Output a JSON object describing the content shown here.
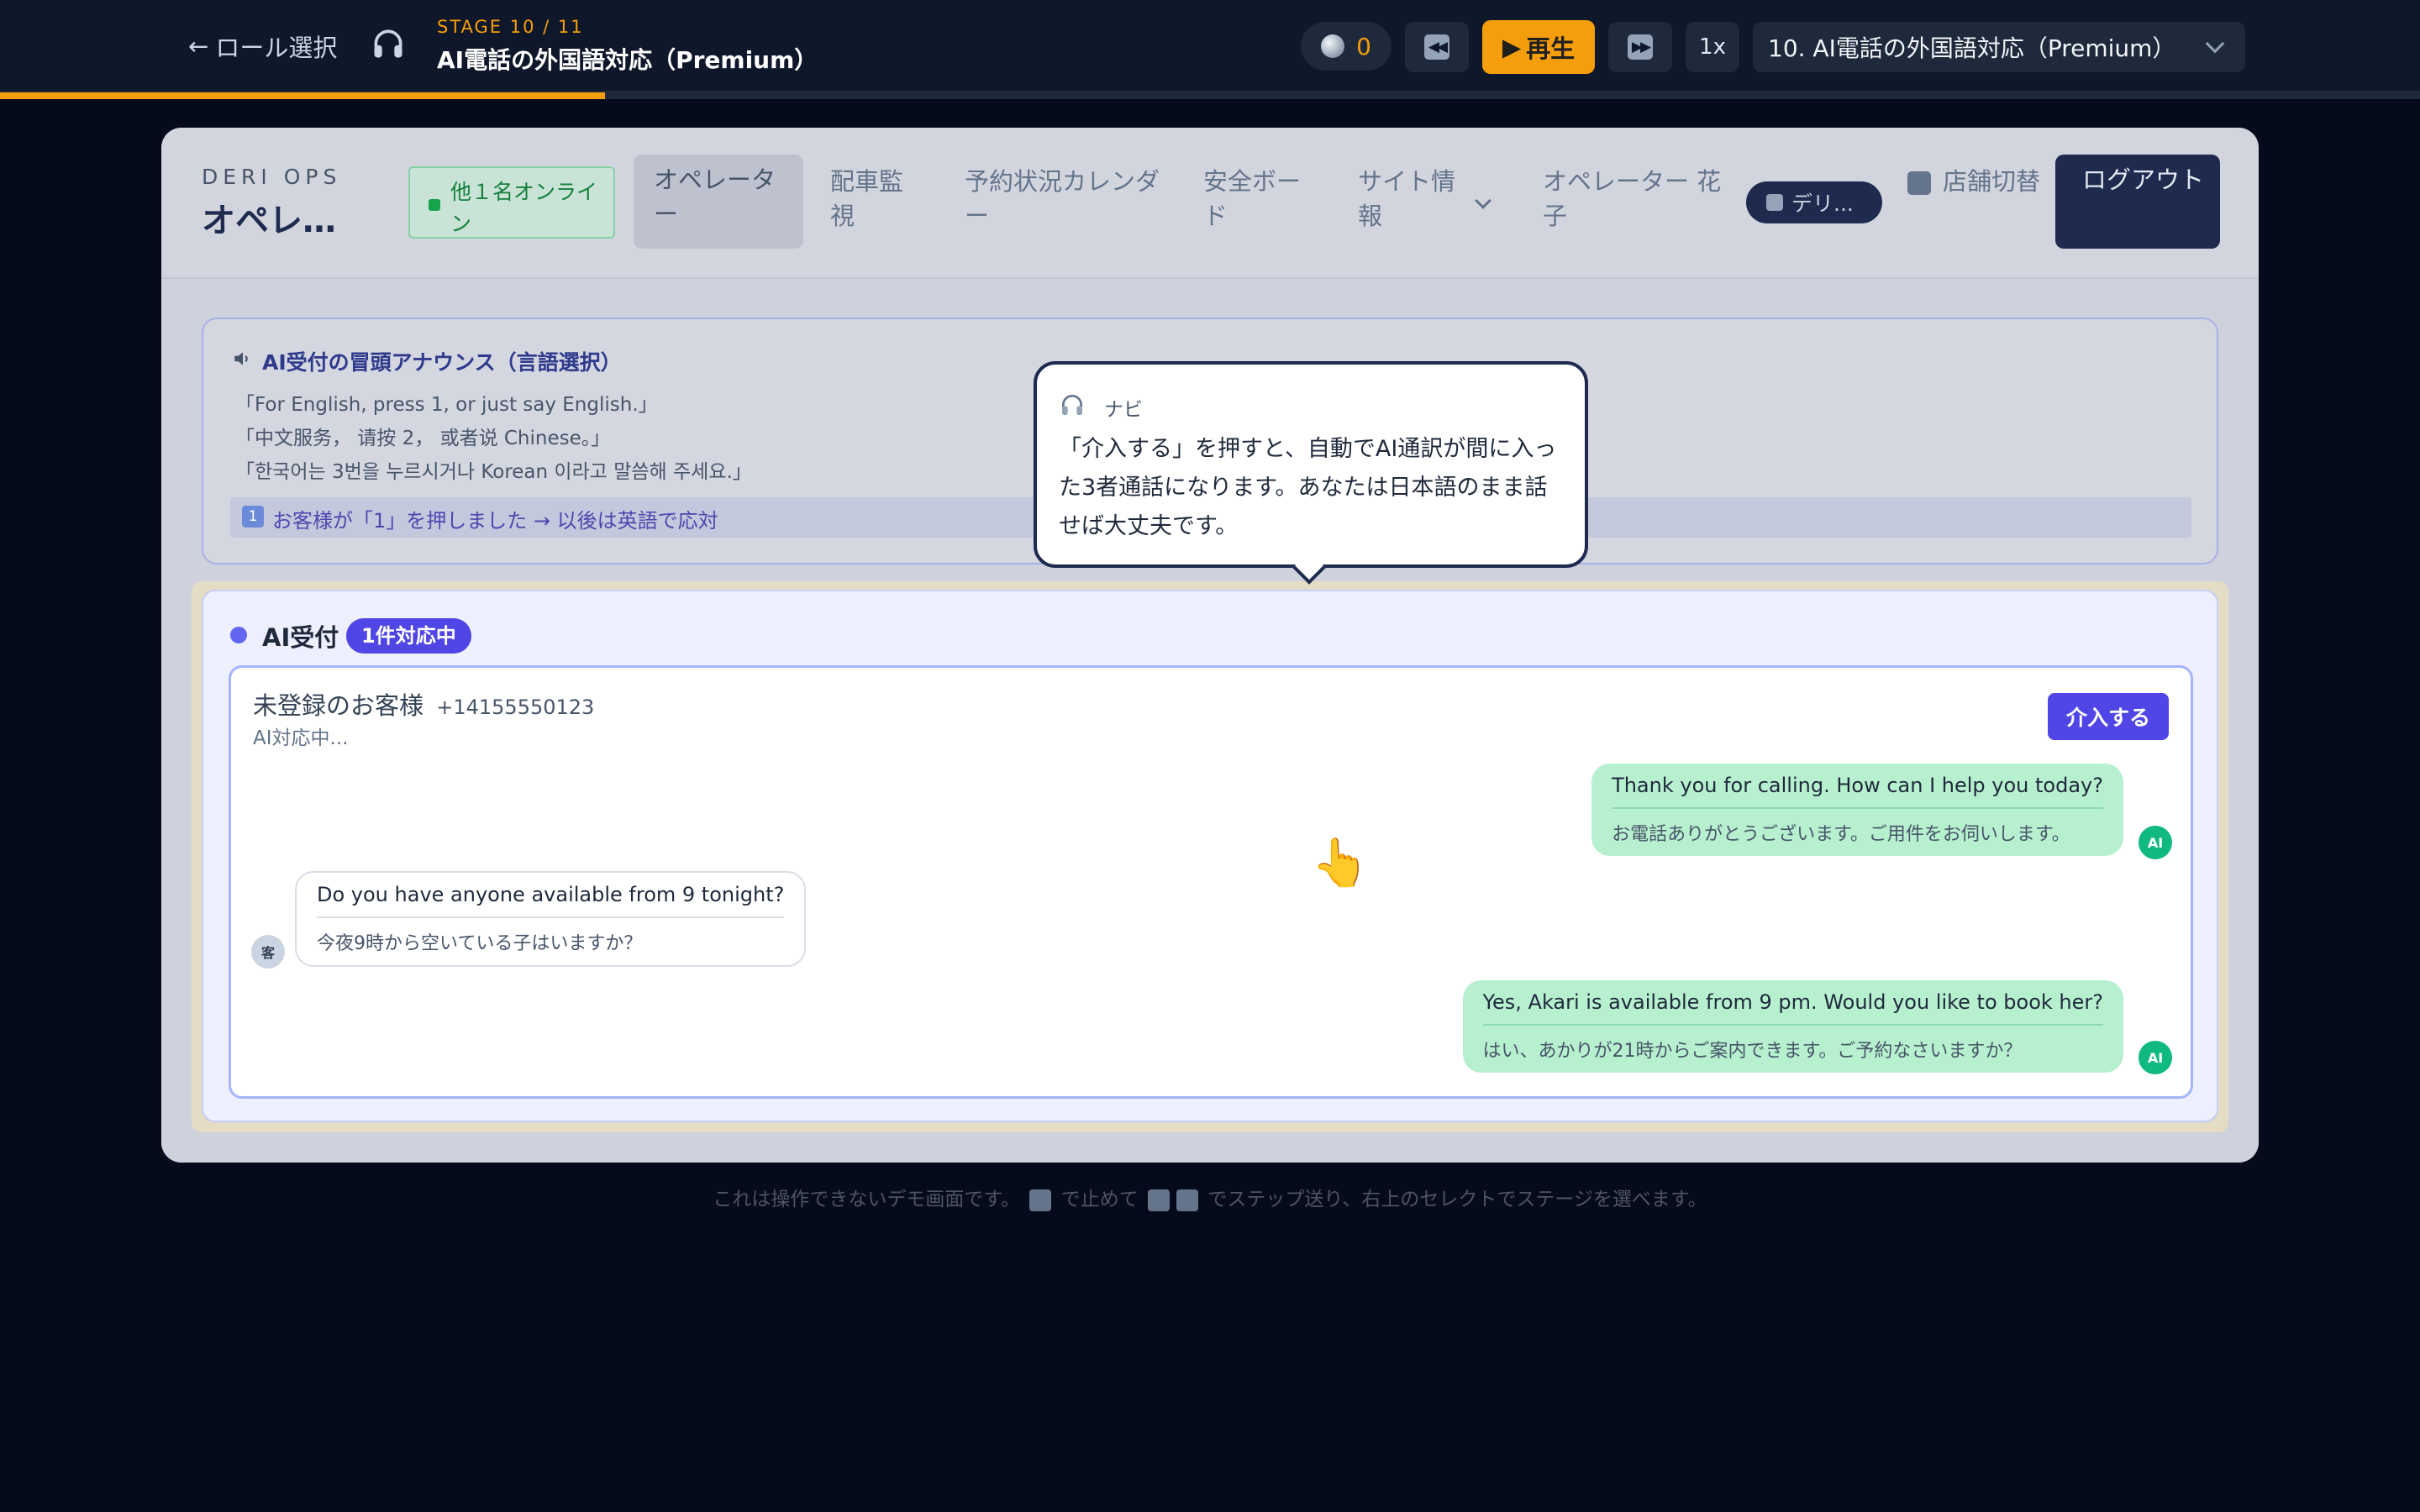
{
  "topbar": {
    "back_label": "ロール選択",
    "stage_label": "STAGE 10 / 11",
    "stage_title": "AI電話の外国語対応（Premium）",
    "coins": "0",
    "play_label": "再生",
    "speed_label": "1x",
    "stage_select_value": "10. AI電話の外国語対応（Premium）",
    "progress_fraction": 0.25,
    "accent_color": "#f59e0b"
  },
  "header": {
    "brand_small": "DERI OPS",
    "brand_big": "オペレ…",
    "online_badge": "他１名オンライン",
    "nav": {
      "operator": "オペレーター",
      "dispatch": "配車監視",
      "calendar": "予約状況カレンダー",
      "safety": "安全ボード",
      "site_info": "サイト情報"
    },
    "user_name": "オペレーター 花子",
    "deli_pill": "デリ...",
    "store_switch": "店舗切替",
    "logout": "ログアウト"
  },
  "announce": {
    "title": "AI受付の冒頭アナウンス（言語選択）",
    "lines": [
      "「For English, press 1, or just say English.」",
      "「中文服务，  请按 2， 或者说 Chinese。」",
      "「한국어는 3번을 누르시거나 Korean 이라고 말씀해 주세요.」"
    ],
    "result_num": "1",
    "result": "お客様が「1」を押しました → 以後は英語で応対"
  },
  "ai_reception": {
    "title": "AI受付",
    "count_badge": "1件対応中",
    "caller_name": "未登録のお客様",
    "caller_number": "+14155550123",
    "caller_status": "AI対応中...",
    "intervene": "介入する",
    "messages": [
      {
        "from": "ai",
        "en": "Thank you for calling. How can I help you today?",
        "ja": "お電話ありがとうございます。ご用件をお伺いします。",
        "avatar": "AI"
      },
      {
        "from": "customer",
        "en": "Do you have anyone available from 9 tonight?",
        "ja": "今夜9時から空いている子はいますか？",
        "avatar": "客"
      },
      {
        "from": "ai",
        "en": "Yes, Akari is available from 9 pm. Would you like to book her?",
        "ja": "はい、あかりが21時からご案内できます。ご予約なさいますか？",
        "avatar": "AI"
      }
    ]
  },
  "tooltip": {
    "label": "ナビ",
    "text": "「介入する」を押すと、自動でAI通訳が間に入った3者通話になります。あなたは日本語のまま話せば大丈夫です。"
  },
  "footer": {
    "part1": "これは操作できないデモ画面です。",
    "part2": "で止めて",
    "part3": "でステップ送り、右上のセレクトでステージを選べます。"
  },
  "icons": [
    "arrow-left-icon",
    "headphones-icon",
    "coin-icon",
    "rewind-icon",
    "play-icon",
    "fast-forward-icon",
    "chevron-down-icon",
    "speaker-icon",
    "pointer-hand-icon"
  ]
}
